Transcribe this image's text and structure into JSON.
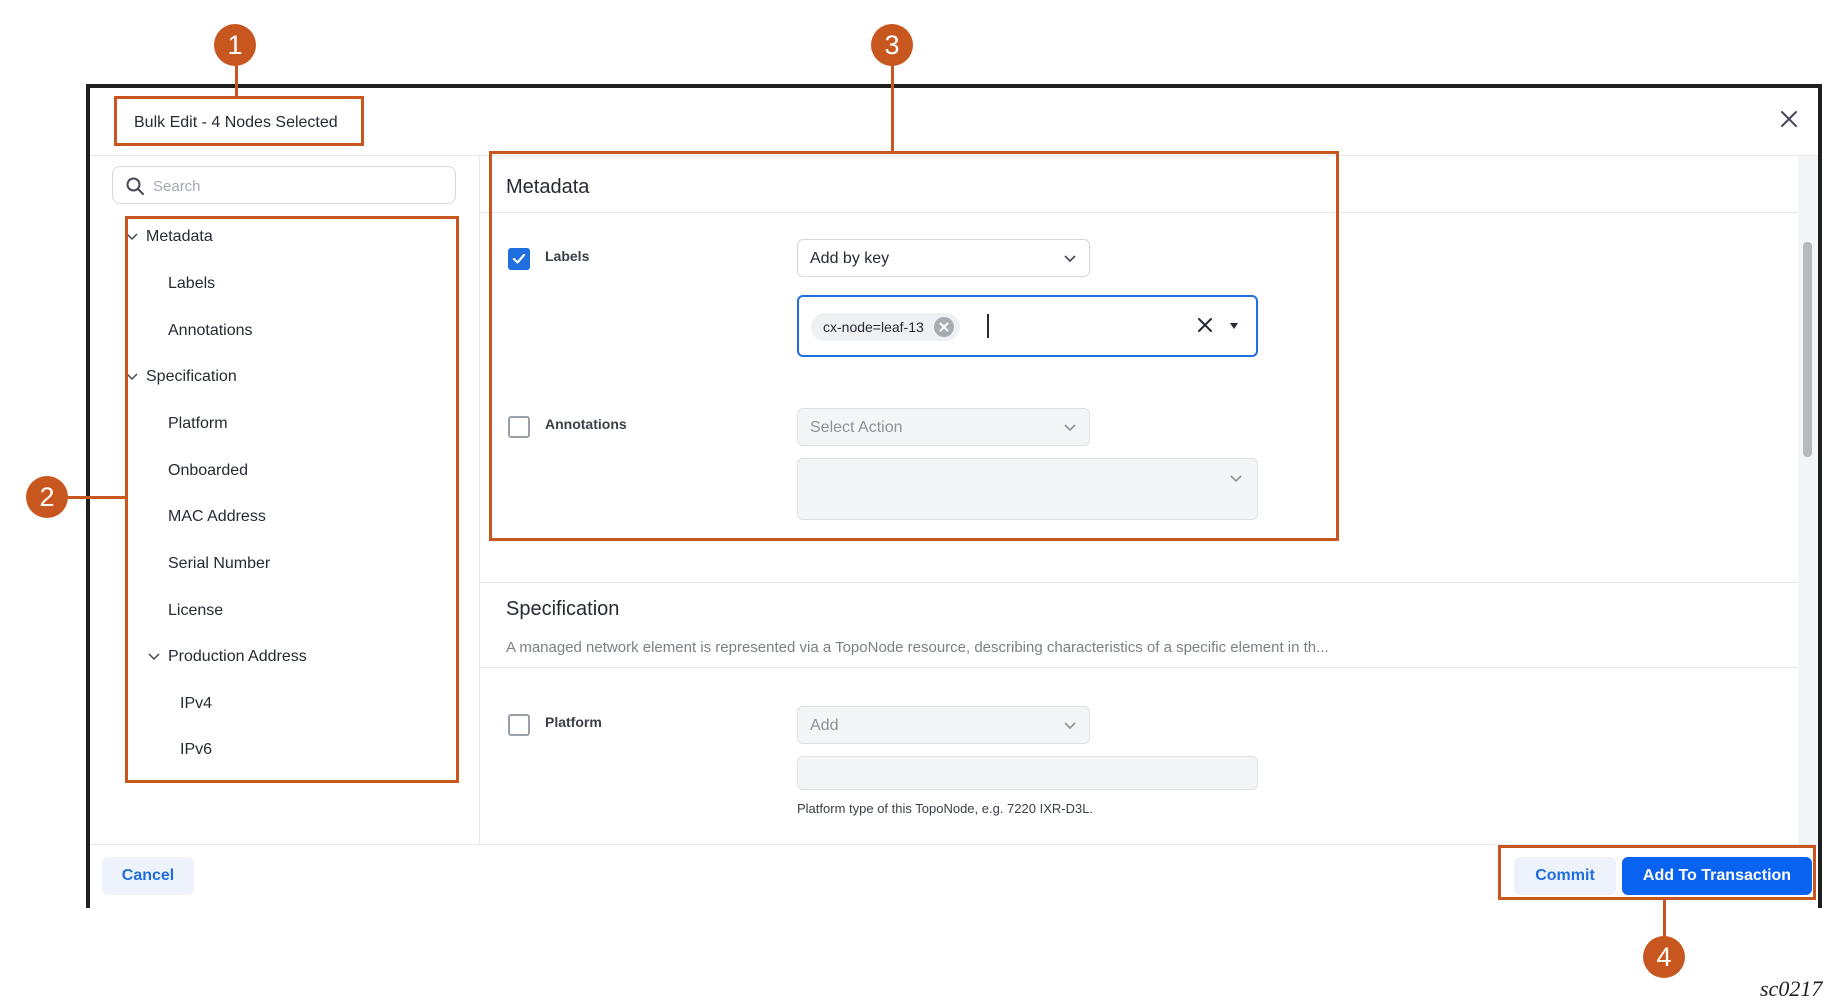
{
  "modal": {
    "title": "Bulk Edit - 4 Nodes Selected",
    "close_icon": "close-icon"
  },
  "sidebar": {
    "search_placeholder": "Search",
    "items": [
      {
        "label": "Metadata",
        "level": 0,
        "expanded": true
      },
      {
        "label": "Labels",
        "level": 1
      },
      {
        "label": "Annotations",
        "level": 1
      },
      {
        "label": "Specification",
        "level": 0,
        "expanded": true
      },
      {
        "label": "Platform",
        "level": 1
      },
      {
        "label": "Onboarded",
        "level": 1
      },
      {
        "label": "MAC Address",
        "level": 1
      },
      {
        "label": "Serial Number",
        "level": 1
      },
      {
        "label": "License",
        "level": 1
      },
      {
        "label": "Production Address",
        "level": 1,
        "expanded": true
      },
      {
        "label": "IPv4",
        "level": 2
      },
      {
        "label": "IPv6",
        "level": 2
      }
    ]
  },
  "metadata": {
    "title": "Metadata",
    "labels": {
      "label": "Labels",
      "checked": true,
      "action": "Add by key",
      "tag": "cx-node=leaf-13"
    },
    "annotations": {
      "label": "Annotations",
      "checked": false,
      "action_placeholder": "Select Action"
    }
  },
  "specification": {
    "title": "Specification",
    "description": "A managed network element is represented via a TopoNode resource, describing characteristics of a specific element in th...",
    "platform": {
      "label": "Platform",
      "checked": false,
      "action": "Add",
      "hint": "Platform type of this TopoNode, e.g. 7220 IXR-D3L."
    }
  },
  "footer": {
    "cancel": "Cancel",
    "commit": "Commit",
    "add_to_transaction": "Add To Transaction"
  },
  "callouts": [
    "1",
    "2",
    "3",
    "4"
  ],
  "figure_id": "sc0217",
  "colors": {
    "accent": "#1f6fde",
    "primary_button": "#0a63f0",
    "callout": "#c8571f"
  }
}
